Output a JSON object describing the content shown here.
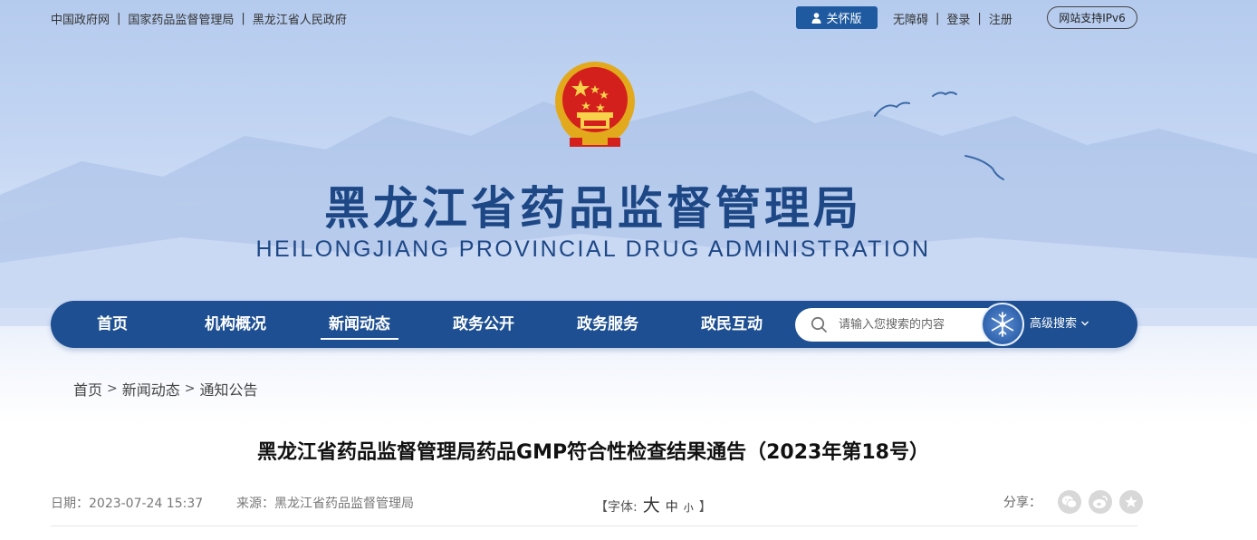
{
  "top_links": [
    "中国政府网",
    "国家药品监督管理局",
    "黑龙江省人民政府"
  ],
  "top_separator": "|",
  "care_mode_label": "关怀版",
  "utility": {
    "accessibility": "无障碍",
    "login": "登录",
    "register": "注册",
    "ipv6": "网站支持IPv6"
  },
  "site": {
    "title": "黑龙江省药品监督管理局",
    "subtitle": "HEILONGJIANG PROVINCIAL DRUG ADMINISTRATION"
  },
  "nav": {
    "items": [
      "首页",
      "机构概况",
      "新闻动态",
      "政务公开",
      "政务服务",
      "政民互动"
    ],
    "active": "新闻动态",
    "search_placeholder": "请输入您搜索的内容",
    "advanced_search": "高级搜索"
  },
  "breadcrumb": [
    "首页",
    "新闻动态",
    "通知公告"
  ],
  "breadcrumb_separator": ">",
  "article": {
    "title": "黑龙江省药品监督管理局药品GMP符合性检查结果通告（2023年第18号）",
    "date": "日期：2023-07-24 15:37",
    "source": "来源：黑龙江省药品监督管理局",
    "font_size": {
      "open": "【字体:",
      "large": "大",
      "medium": "中",
      "small": "小",
      "close": "】"
    },
    "share_label": "分享："
  },
  "icons": [
    "person-icon",
    "search-icon",
    "snowflake-icon",
    "chevron-down-icon",
    "wechat-icon",
    "weibo-icon",
    "favorite-icon"
  ],
  "colors": {
    "nav_bg": "#1d4f92",
    "title_blue": "#1d4785",
    "care_button": "#1f5aa0"
  }
}
